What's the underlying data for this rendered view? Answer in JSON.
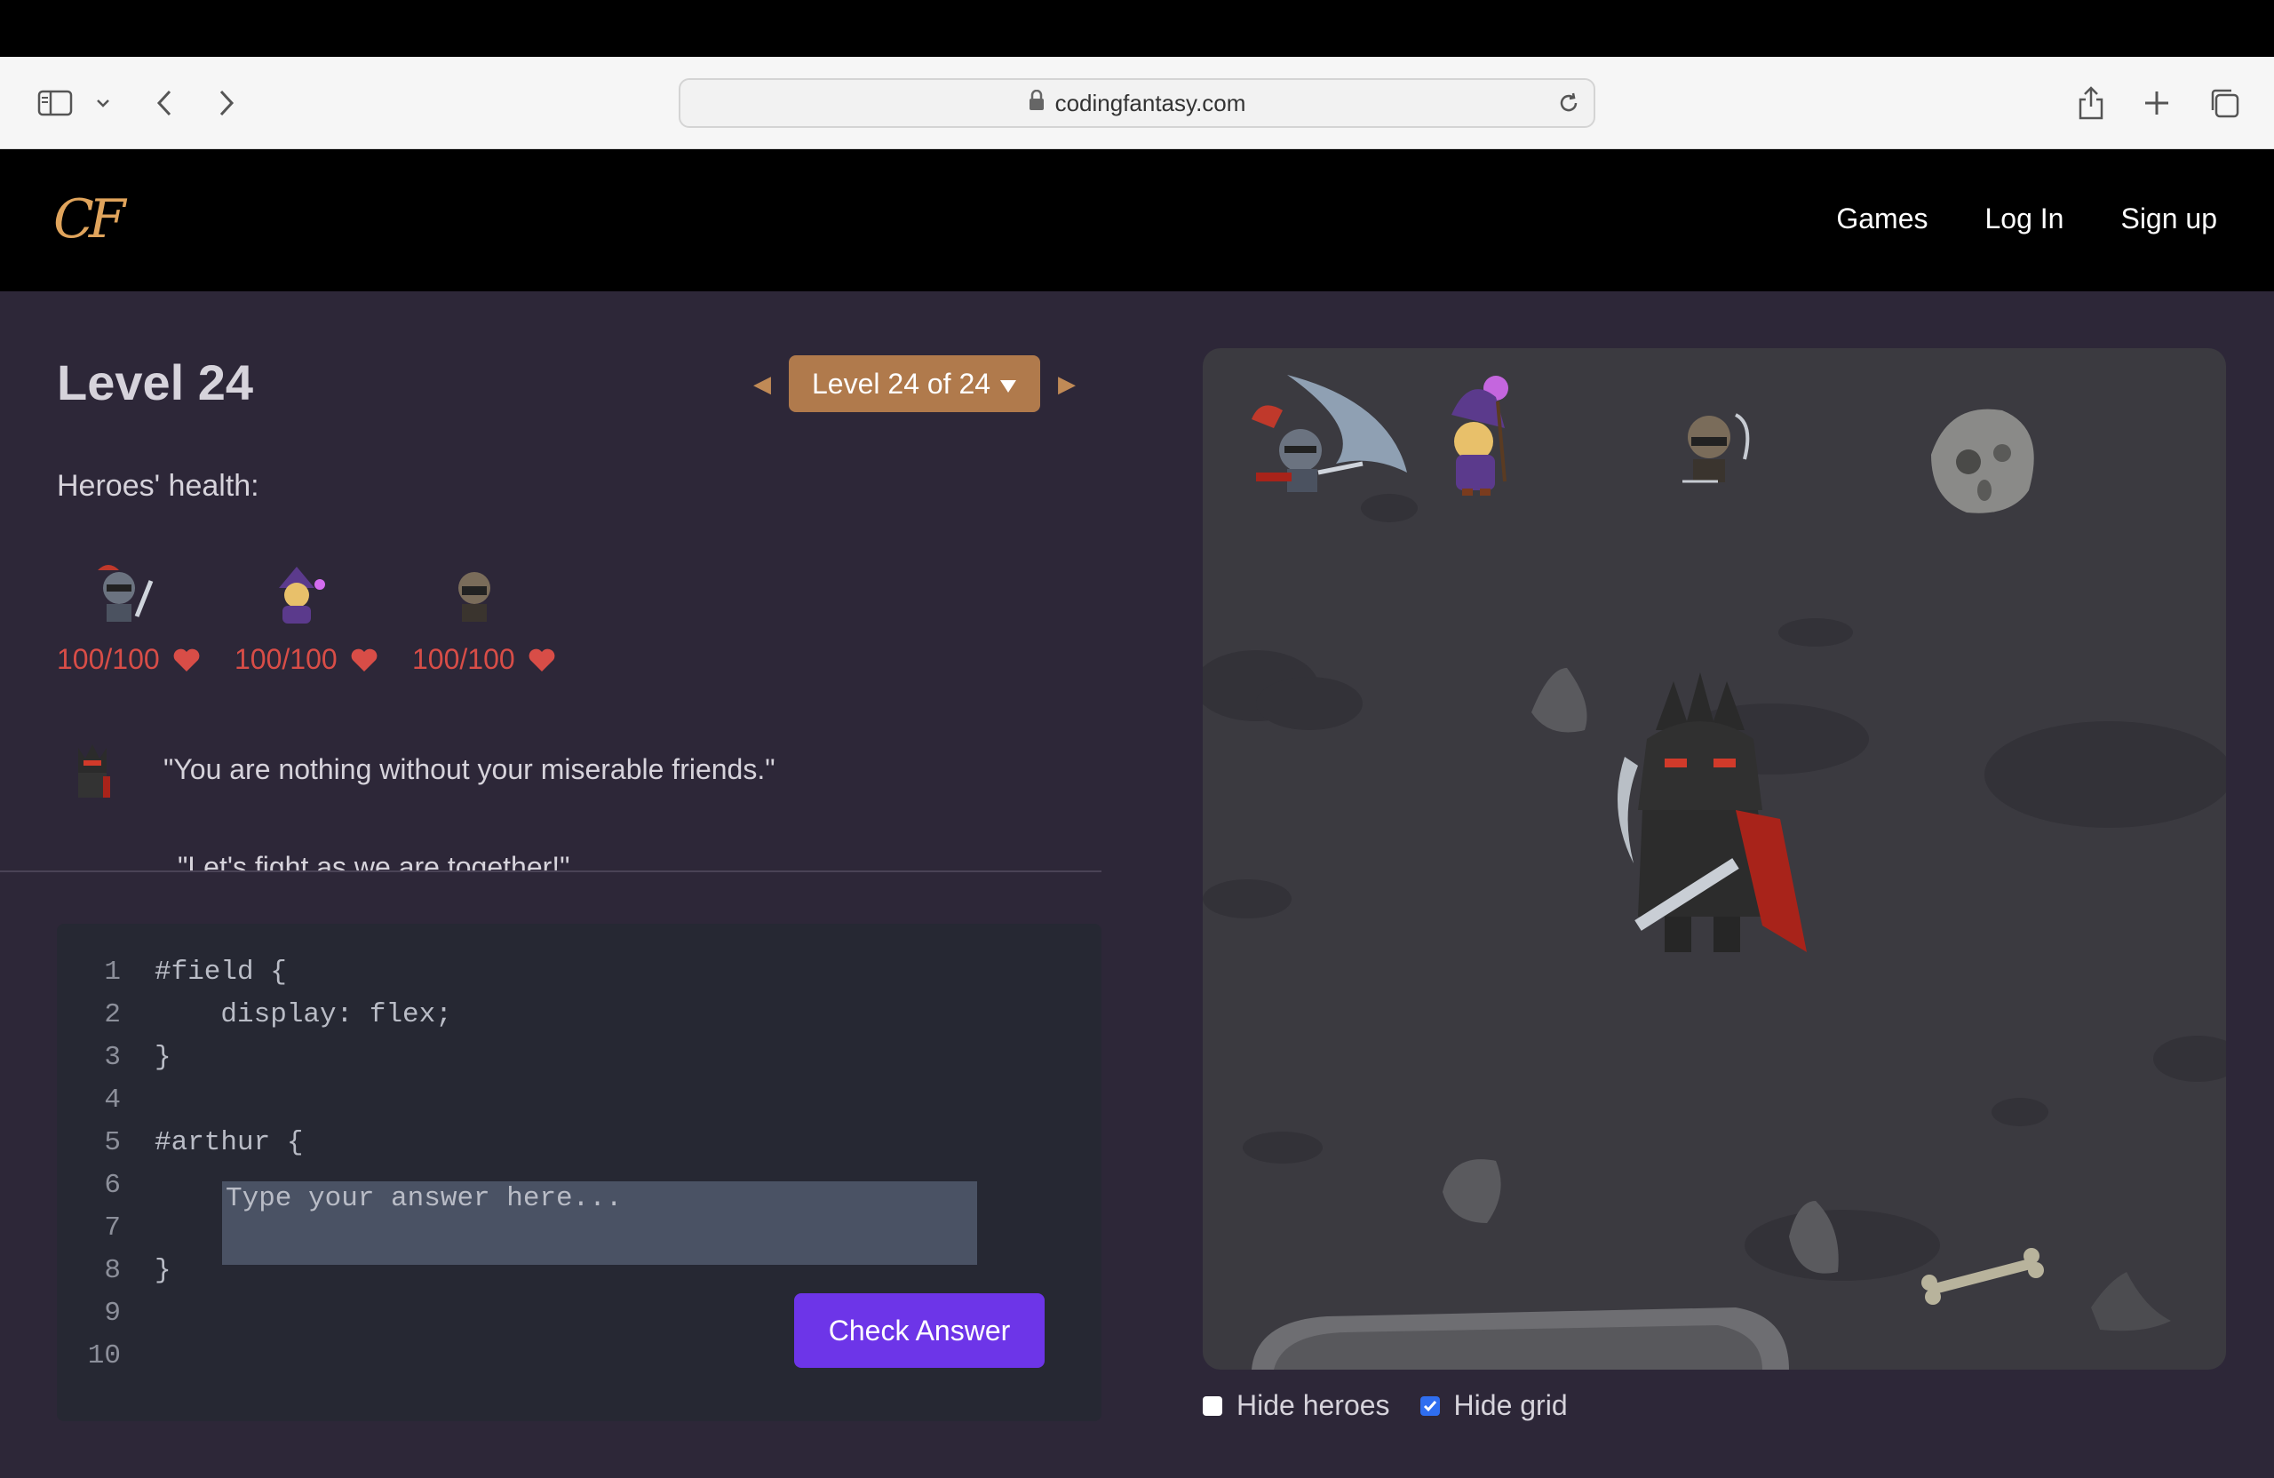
{
  "browser": {
    "url": "codingfantasy.com"
  },
  "site": {
    "logo": "CF",
    "nav": [
      "Games",
      "Log In",
      "Sign up"
    ]
  },
  "level": {
    "title": "Level 24",
    "selector": "Level 24 of 24",
    "prev_arrow": "◀",
    "next_arrow": "▶"
  },
  "health": {
    "label": "Heroes' health:",
    "heroes": [
      {
        "name": "arthur",
        "value": "100/100"
      },
      {
        "name": "mage",
        "value": "100/100"
      },
      {
        "name": "ninja",
        "value": "100/100"
      }
    ]
  },
  "dialogue": {
    "quote": "\"You are nothing without your miserable friends.\"",
    "quote2_partial": "\"Let's fight as we are together!\""
  },
  "editor": {
    "lines": [
      {
        "n": "1",
        "code": "#field {"
      },
      {
        "n": "2",
        "code": "    display: flex;"
      },
      {
        "n": "3",
        "code": "}"
      },
      {
        "n": "4",
        "code": ""
      },
      {
        "n": "5",
        "code": "#arthur {"
      },
      {
        "n": "6",
        "code": ""
      },
      {
        "n": "7",
        "code": ""
      },
      {
        "n": "8",
        "code": "}"
      },
      {
        "n": "9",
        "code": ""
      },
      {
        "n": "10",
        "code": ""
      }
    ],
    "answer_placeholder": "Type your answer here...",
    "check_label": "Check Answer"
  },
  "board_controls": {
    "hide_heroes": {
      "label": "Hide heroes",
      "checked": false
    },
    "hide_grid": {
      "label": "Hide grid",
      "checked": true
    }
  },
  "colors": {
    "accent": "#6d35e8",
    "level_select": "#b07a4c",
    "health": "#d84d47",
    "logo": "#e0a45c"
  }
}
